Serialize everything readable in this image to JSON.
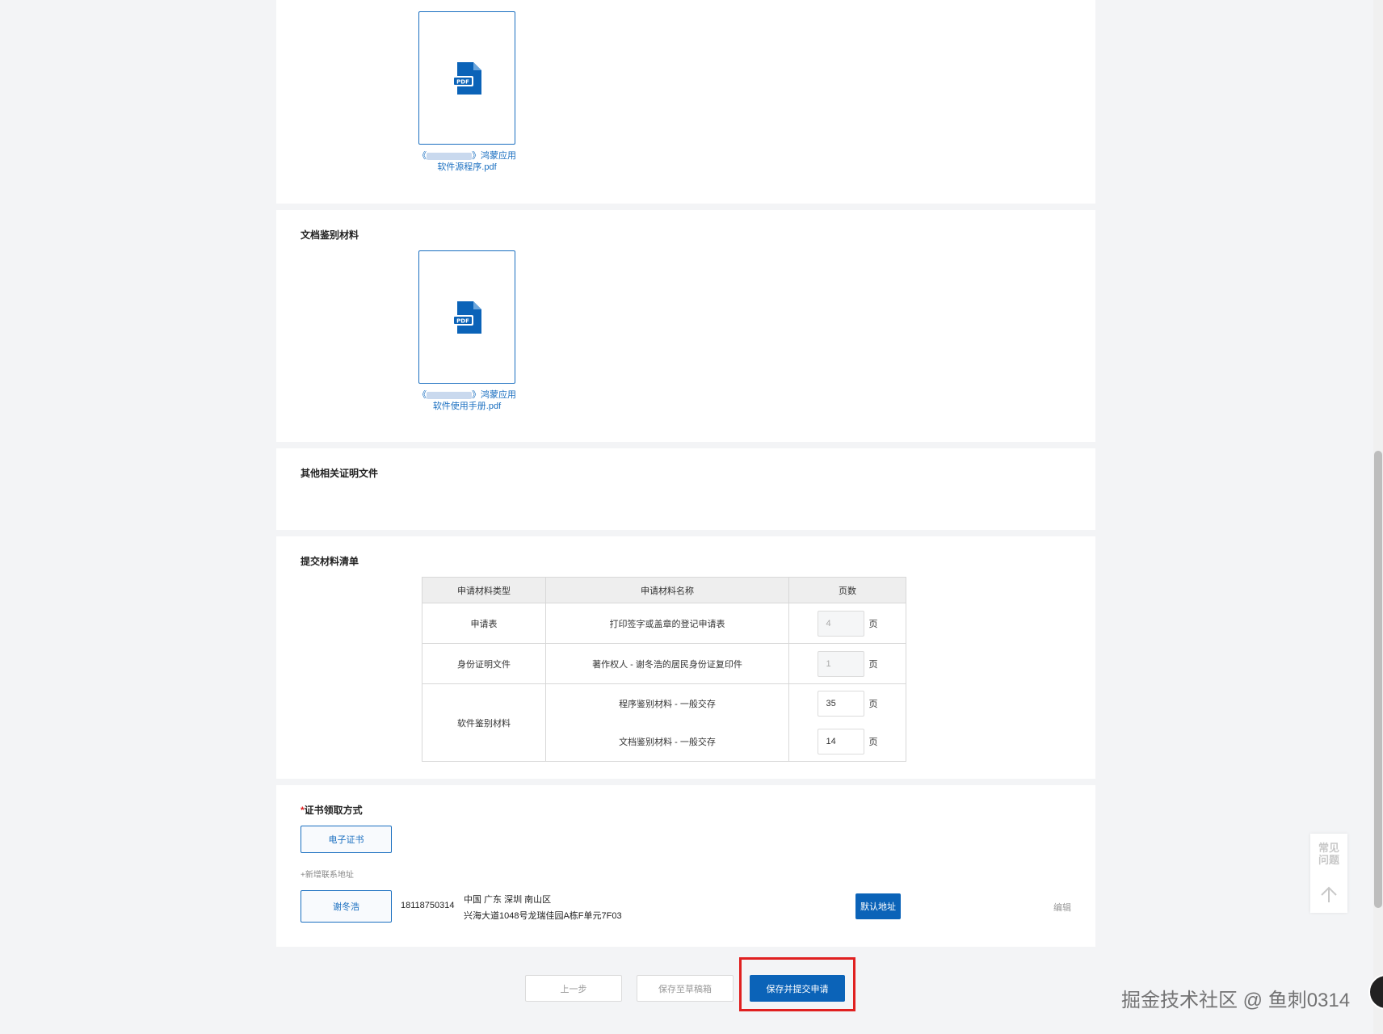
{
  "source_file": {
    "name_line1_suffix": "》鸿蒙应用",
    "name_line1_prefix": "《",
    "name_line2": "软件源程序.pdf"
  },
  "doc_section": {
    "title": "文档鉴别材料",
    "name_line1_prefix": "《",
    "name_line1_suffix": "》鸿蒙应用",
    "name_line2": "软件使用手册.pdf"
  },
  "other_section": {
    "title": "其他相关证明文件"
  },
  "list_section": {
    "title": "提交材料清单",
    "headers": [
      "申请材料类型",
      "申请材料名称",
      "页数"
    ],
    "rows": [
      {
        "type": "申请表",
        "name": "打印签字或盖章的登记申请表",
        "pages": "4",
        "unit": "页"
      },
      {
        "type": "身份证明文件",
        "name": "著作权人 - 谢冬浩的居民身份证复印件",
        "pages": "1",
        "unit": "页"
      },
      {
        "type": "软件鉴别材料",
        "name": "程序鉴别材料 - 一般交存",
        "pages": "35",
        "unit": "页"
      },
      {
        "type": "",
        "name": "文档鉴别材料 - 一般交存",
        "pages": "14",
        "unit": "页"
      }
    ]
  },
  "cert_section": {
    "required_mark": "*",
    "title": "证书领取方式",
    "option": "电子证书",
    "add_address": "+新增联系地址",
    "contact_name": "谢冬浩",
    "phone": "18118750314",
    "address_line1": "中国 广东 深圳 南山区",
    "address_line2": "兴海大道1048号龙瑞佳园A栋F单元7F03",
    "default_label": "默认地址",
    "edit_label": "编辑"
  },
  "footer": {
    "prev": "上一步",
    "save_draft": "保存至草稿箱",
    "submit": "保存并提交申请"
  },
  "faq": {
    "line1": "常见",
    "line2": "问题"
  },
  "watermark": "掘金技术社区 @ 鱼刺0314",
  "icons": {
    "file": "pdf-file-icon",
    "top": "arrow-up-icon"
  },
  "colors": {
    "primary": "#0b63b8",
    "highlight": "#e02020"
  }
}
